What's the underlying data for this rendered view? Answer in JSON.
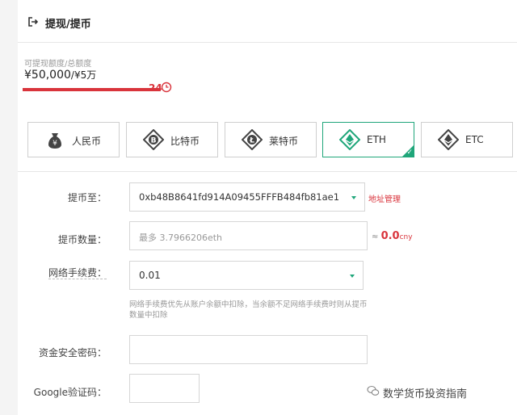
{
  "header": {
    "title": "提现/提币",
    "icon": "logout-icon"
  },
  "quota": {
    "label": "可提现额度/总额度",
    "available": "¥50,000",
    "total": "/¥5万",
    "progress_fraction": 1.0,
    "badge": "24h",
    "badge_number": "24"
  },
  "tabs": [
    {
      "label": "人民币",
      "icon": "money-bag-icon"
    },
    {
      "label": "比特币",
      "icon": "bitcoin-icon"
    },
    {
      "label": "莱特币",
      "icon": "litecoin-icon"
    },
    {
      "label": "ETH",
      "icon": "ethereum-icon",
      "active": true
    },
    {
      "label": "ETC",
      "icon": "ethereum-classic-icon"
    }
  ],
  "form": {
    "address_label": "提币至：",
    "address_value": "0xb48B8641fd914A09455FFFB484fb81ae1",
    "address_manage": "地址管理",
    "amount_label": "提币数量：",
    "amount_placeholder": "最多 3.7966206eth",
    "approx_symbol": "≈",
    "approx_value": "0.0",
    "approx_unit": "cny",
    "fee_label": "网络手续费：",
    "fee_value": "0.01",
    "fee_note": "网络手续费优先从账户余额中扣除，当余额不足网络手续费时则从提币数量中扣除",
    "password_label": "资金安全密码：",
    "google_label": "Google验证码："
  },
  "watermark": {
    "text": "数学货币投资指南",
    "icon": "wechat-icon"
  },
  "colors": {
    "accent": "#1fa67a",
    "danger": "#d9343c"
  }
}
